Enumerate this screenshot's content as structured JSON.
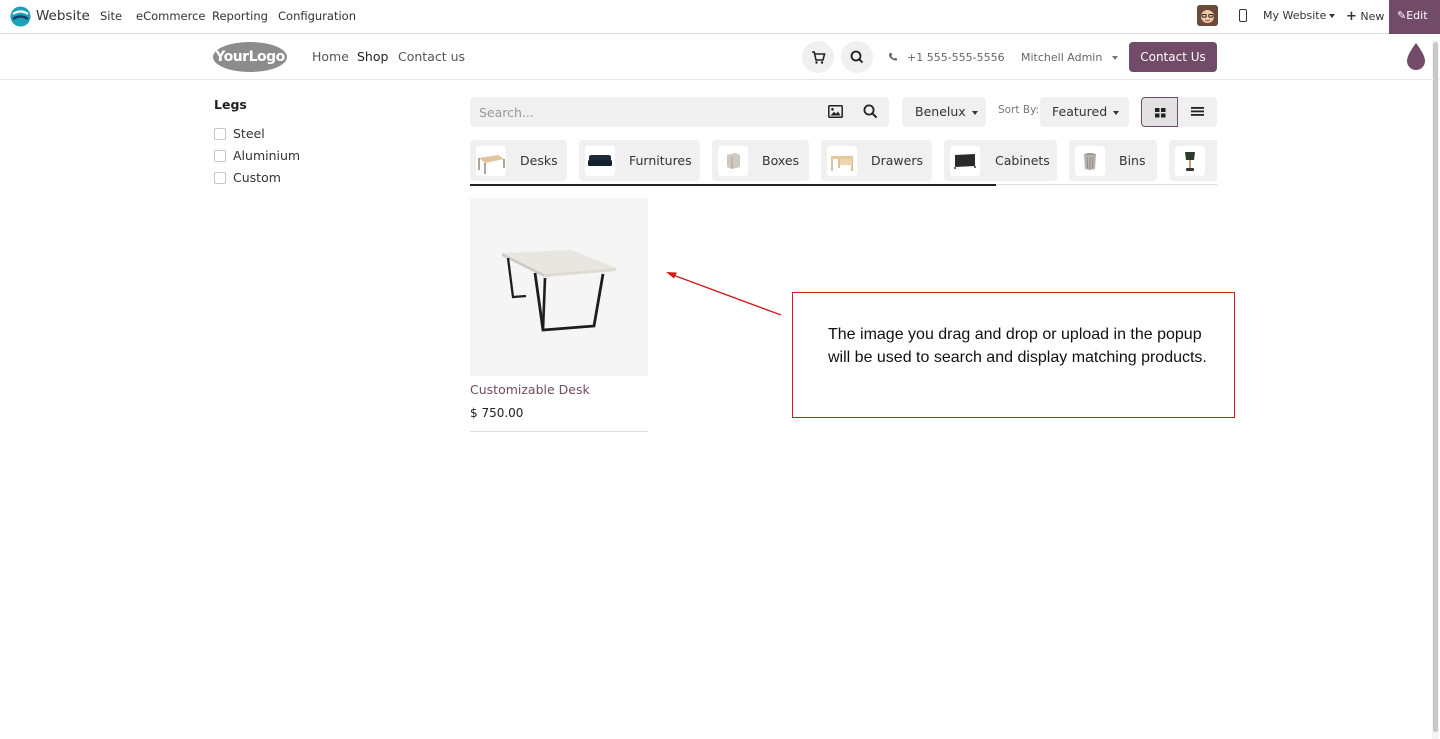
{
  "topbar": {
    "app_name": "Website",
    "menus": [
      "Site",
      "eCommerce",
      "Reporting",
      "Configuration"
    ],
    "my_website": "My Website",
    "new": "New",
    "edit": "Edit"
  },
  "header": {
    "logo": "YourLogo",
    "nav": [
      "Home",
      "Shop",
      "Contact us"
    ],
    "active_nav": "Shop",
    "phone": "+1 555-555-5556",
    "user": "Mitchell Admin",
    "contact_button": "Contact Us"
  },
  "filters": {
    "title": "Legs",
    "options": [
      "Steel",
      "Aluminium",
      "Custom"
    ]
  },
  "search": {
    "placeholder": "Search...",
    "pricelist": "Benelux",
    "sort_label": "Sort By:",
    "sort_value": "Featured"
  },
  "categories": [
    "Desks",
    "Furnitures",
    "Boxes",
    "Drawers",
    "Cabinets",
    "Bins",
    ""
  ],
  "product": {
    "name": "Customizable Desk",
    "price": "$ 750.00"
  },
  "annotation": {
    "line1": "The image you drag and drop or upload in the popup",
    "line2": "will be used to search and display matching products."
  },
  "colors": {
    "brand": "#714b67",
    "annotation": "#d01c1c"
  }
}
